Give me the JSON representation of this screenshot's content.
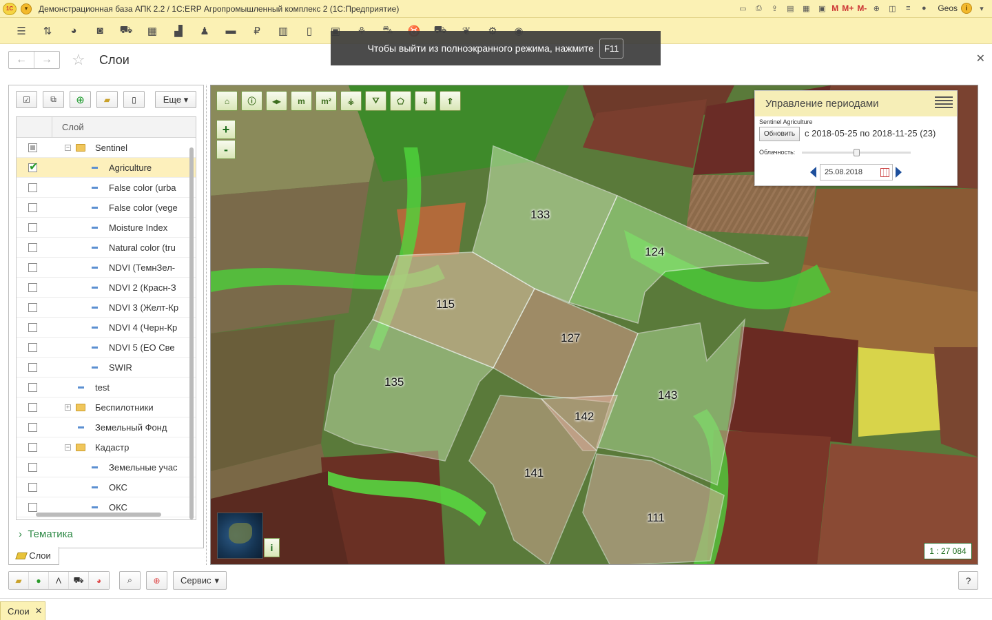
{
  "app": {
    "title": "Демонстрационная база АПК 2.2 / 1С:ERP Агропромышленный комплекс 2  (1С:Предприятие)",
    "logo_text": "1С",
    "user": "Geos",
    "m_labels": [
      "M",
      "M+",
      "M-"
    ]
  },
  "fullscreen_tip": {
    "text": "Чтобы выйти из полноэкранного режима, нажмите",
    "key": "F11"
  },
  "page": {
    "title": "Слои"
  },
  "layers_panel": {
    "more_label": "Еще",
    "column_header": "Слой",
    "rows": [
      {
        "label": "Sentinel",
        "indent": 1,
        "kind": "folder",
        "expanded": true,
        "check": "partial"
      },
      {
        "label": "Agriculture",
        "indent": 2,
        "kind": "layer",
        "check": "on",
        "selected": true
      },
      {
        "label": "False color (urba",
        "indent": 2,
        "kind": "layer",
        "check": "off"
      },
      {
        "label": "False color (vege",
        "indent": 2,
        "kind": "layer",
        "check": "off"
      },
      {
        "label": "Moisture Index",
        "indent": 2,
        "kind": "layer",
        "check": "off"
      },
      {
        "label": "Natural color (tru",
        "indent": 2,
        "kind": "layer",
        "check": "off"
      },
      {
        "label": "NDVI (ТемнЗел-",
        "indent": 2,
        "kind": "layer",
        "check": "off"
      },
      {
        "label": "NDVI 2 (Красн-З",
        "indent": 2,
        "kind": "layer",
        "check": "off"
      },
      {
        "label": "NDVI 3 (Желт-Кр",
        "indent": 2,
        "kind": "layer",
        "check": "off"
      },
      {
        "label": "NDVI 4 (Черн-Кр",
        "indent": 2,
        "kind": "layer",
        "check": "off"
      },
      {
        "label": "NDVI 5 (ЕО Све",
        "indent": 2,
        "kind": "layer",
        "check": "off"
      },
      {
        "label": "SWIR",
        "indent": 2,
        "kind": "layer",
        "check": "off"
      },
      {
        "label": "test",
        "indent": 1,
        "kind": "layer",
        "check": "off"
      },
      {
        "label": "Беспилотники",
        "indent": 1,
        "kind": "folder",
        "expanded": false,
        "check": "off"
      },
      {
        "label": "Земельный Фонд",
        "indent": 1,
        "kind": "layer",
        "check": "off"
      },
      {
        "label": "Кадастр",
        "indent": 1,
        "kind": "folder",
        "expanded": true,
        "check": "off"
      },
      {
        "label": "Земельные учас",
        "indent": 2,
        "kind": "layer",
        "check": "off"
      },
      {
        "label": "ОКС",
        "indent": 2,
        "kind": "layer",
        "check": "off"
      },
      {
        "label": "ОКС",
        "indent": 2,
        "kind": "layer",
        "check": "off"
      }
    ],
    "tematika_label": "Тематика",
    "tab_label": "Слои"
  },
  "period_panel": {
    "title": "Управление периодами",
    "source": "Sentinel Agriculture",
    "refresh_label": "Обновить",
    "range": "с 2018-05-25 по 2018-11-25 (23)",
    "cloudiness_label": "Облачность:",
    "date": "25.08.2018"
  },
  "fields": [
    "133",
    "124",
    "115",
    "127",
    "135",
    "143",
    "142",
    "141",
    "111"
  ],
  "map": {
    "zoom_in": "+",
    "zoom_out": "-",
    "info_label": "i",
    "scale": "1 : 27 084"
  },
  "bottom": {
    "service_label": "Сервис",
    "help_label": "?"
  },
  "window_tab": {
    "label": "Слои"
  }
}
